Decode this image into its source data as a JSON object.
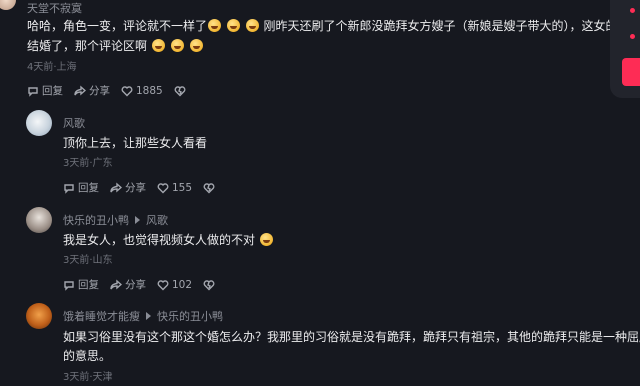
{
  "top_comment": {
    "username": "天堂不寂寞",
    "text_line1": "哈哈，角色一变，评论就不一样了",
    "text_line1_b": "刚昨天还刷了个新郎没跪拜女方嫂子（新娘是嫂子带大的），这女的还",
    "text_line2": "结婚了，那个评论区啊",
    "time_location": "4天前·上海",
    "reply_label": "回复",
    "share_label": "分享",
    "like_count": "1885"
  },
  "replies": [
    {
      "username": "风歌",
      "text": "顶你上去，让那些女人看看",
      "time_location": "3天前·广东",
      "reply_label": "回复",
      "share_label": "分享",
      "like_count": "155"
    },
    {
      "username": "快乐的丑小鸭",
      "reply_to": "风歌",
      "text": "我是女人，也觉得视频女人做的不对",
      "time_location": "3天前·山东",
      "reply_label": "回复",
      "share_label": "分享",
      "like_count": "102"
    },
    {
      "username": "饿着睡觉才能瘦",
      "reply_to": "快乐的丑小鸭",
      "text_line1": "如果习俗里没有这个那这个婚怎么办？我那里的习俗就是没有跪拜，跪拜只有祖宗，其他的跪拜只能是一种屈服",
      "text_line2": "的意思。",
      "time_location": "3天前·天津"
    }
  ],
  "colors": {
    "background": "#16181f",
    "accent": "#fe2c55",
    "muted": "#6f727b"
  },
  "icons": [
    "reply-icon",
    "share-icon",
    "heart-icon",
    "dislike-heart-icon",
    "laughing-emoji",
    "grimace-emoji"
  ]
}
